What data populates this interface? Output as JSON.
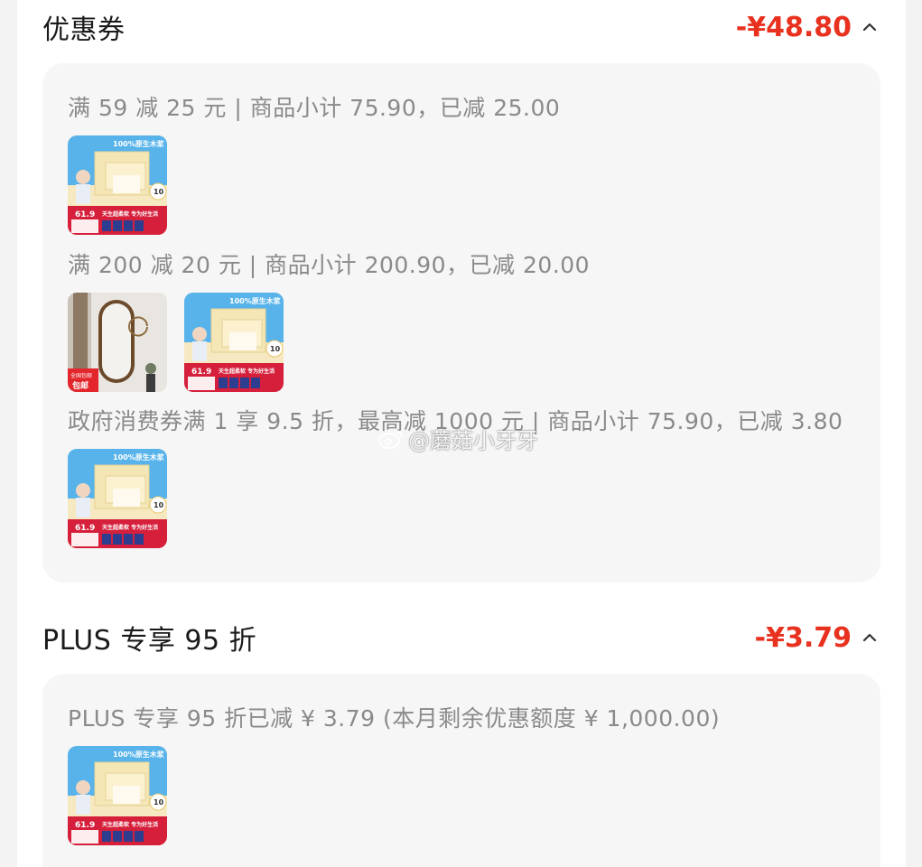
{
  "coupons": {
    "title": "优惠券",
    "amount": "-¥48.80",
    "groups": [
      {
        "label": "满 59 减 25 元 | 商品小计 75.90，已减 25.00"
      },
      {
        "label": "满 200 减 20 元 | 商品小计 200.90，已减 20.00"
      },
      {
        "label": "政府消费券满 1 享 9.5 折，最高减 1000 元 | 商品小计 75.90，已减 3.80"
      }
    ]
  },
  "plus": {
    "title": "PLUS 专享 95 折",
    "amount": "-¥3.79",
    "groups": [
      {
        "label": "PLUS 专享 95 折已减 ¥ 3.79 (本月剩余优惠额度 ¥ 1,000.00)"
      }
    ]
  },
  "product_thumb": {
    "headline": "100%原生木浆",
    "price": "61.9",
    "slogan": "天生超柔软 专为好生活",
    "badge": "10"
  },
  "mirror_thumb": {
    "tag_line1": "全国包邮",
    "tag_line2": "包邮"
  },
  "watermark": "@蘑菇小牙牙",
  "colors": {
    "accent": "#e8321f",
    "card_bg": "#f6f6f6",
    "muted_text": "#8a8a8a"
  }
}
